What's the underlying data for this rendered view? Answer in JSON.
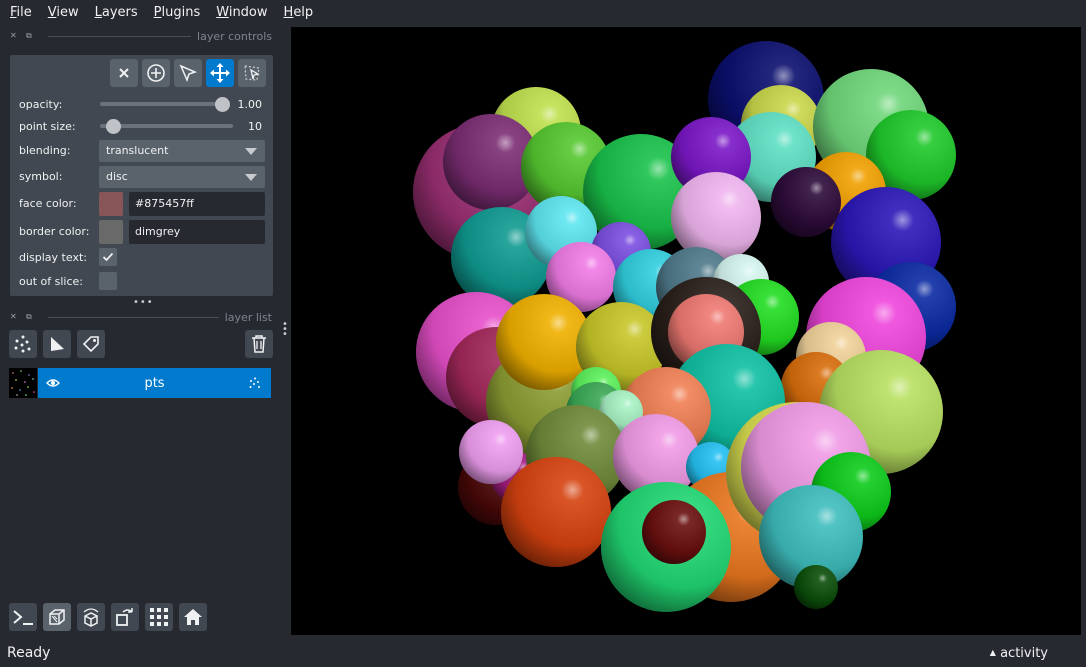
{
  "menubar": {
    "items": [
      {
        "pre": "",
        "u": "F",
        "post": "ile"
      },
      {
        "pre": "",
        "u": "V",
        "post": "iew"
      },
      {
        "pre": "",
        "u": "L",
        "post": "ayers"
      },
      {
        "pre": "",
        "u": "P",
        "post": "lugins"
      },
      {
        "pre": "",
        "u": "W",
        "post": "indow"
      },
      {
        "pre": "",
        "u": "H",
        "post": "elp"
      }
    ]
  },
  "layer_controls": {
    "title": "layer controls",
    "opacity": {
      "label": "opacity:",
      "value": "1.00",
      "fraction": 1.0
    },
    "point_size": {
      "label": "point size:",
      "value": "10",
      "fraction": 0.1
    },
    "blending": {
      "label": "blending:",
      "value": "translucent"
    },
    "symbol": {
      "label": "symbol:",
      "value": "disc"
    },
    "face_color": {
      "label": "face color:",
      "value": "#875457ff",
      "swatch": "#875457"
    },
    "border_color": {
      "label": "border color:",
      "value": "dimgrey",
      "swatch": "#696969"
    },
    "display_text": {
      "label": "display text:",
      "checked": true
    },
    "out_of_slice": {
      "label": "out of slice:",
      "checked": false
    }
  },
  "layer_list": {
    "title": "layer list",
    "layers": [
      {
        "name": "pts",
        "visible": true
      }
    ]
  },
  "status": {
    "text": "Ready",
    "activity": "activity"
  },
  "colors": {
    "accent": "#007acc",
    "background": "#262930",
    "panel": "#414851"
  }
}
